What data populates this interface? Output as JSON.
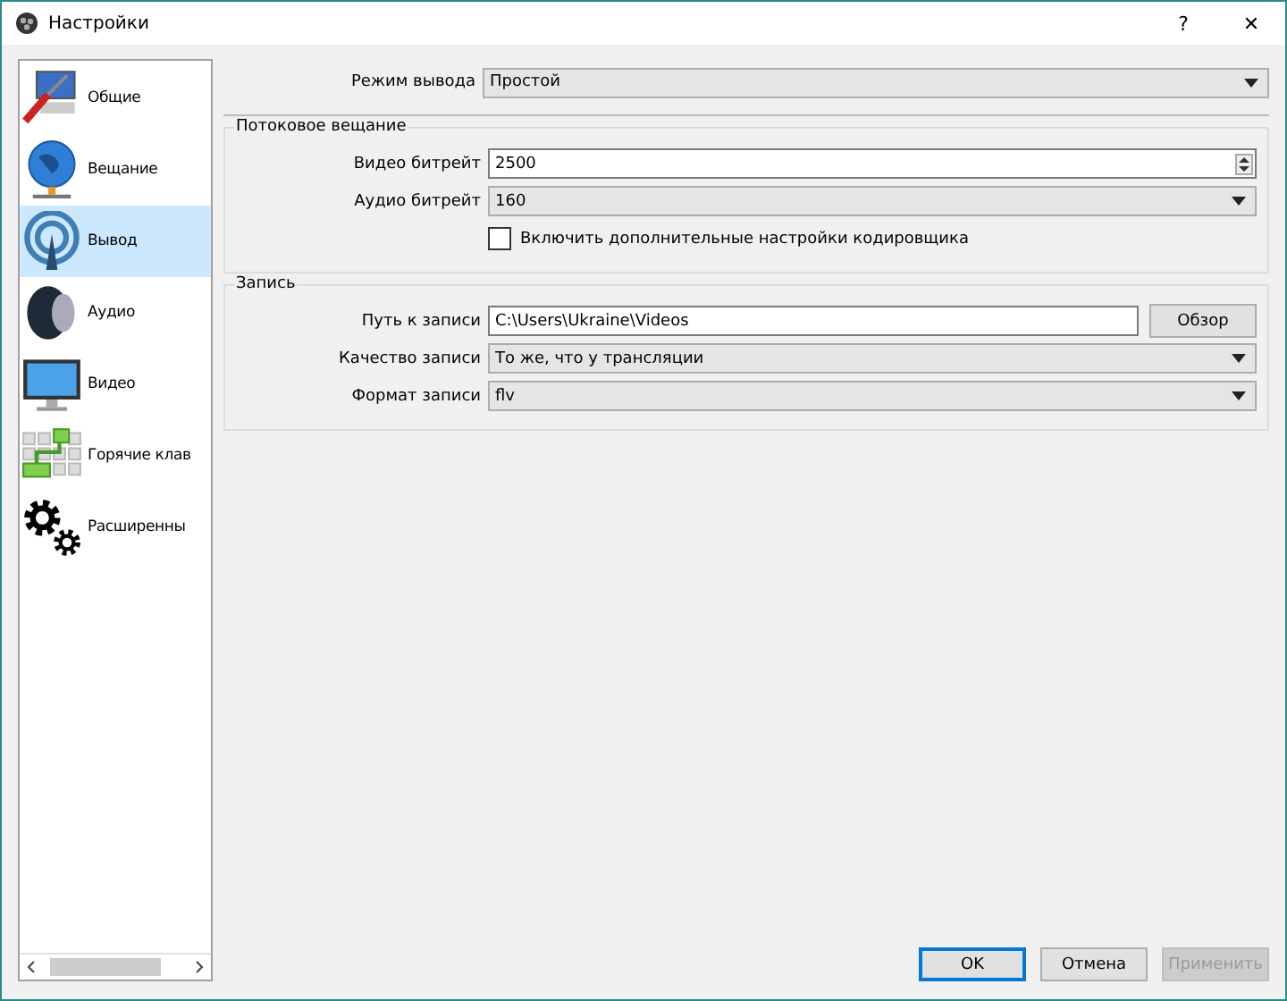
{
  "window": {
    "title": "Настройки",
    "help": "?",
    "close": "✕"
  },
  "sidebar": {
    "items": [
      {
        "label": "Общие",
        "kind": "general",
        "selected": false
      },
      {
        "label": "Вещание",
        "kind": "stream",
        "selected": false
      },
      {
        "label": "Вывод",
        "kind": "output",
        "selected": true
      },
      {
        "label": "Аудио",
        "kind": "audio",
        "selected": false
      },
      {
        "label": "Видео",
        "kind": "video",
        "selected": false
      },
      {
        "label": "Горячие клав",
        "kind": "hotkeys",
        "selected": false
      },
      {
        "label": "Расширенны",
        "kind": "advanced",
        "selected": false
      }
    ]
  },
  "top": {
    "label": "Режим вывода",
    "kind": "combo",
    "value": "Простой"
  },
  "groups": [
    {
      "title": "Потоковое вещание",
      "fields": [
        {
          "label": "Видео битрейт",
          "kind": "spin",
          "value": "2500"
        },
        {
          "label": "Аудио битрейт",
          "kind": "combo",
          "value": "160"
        },
        {
          "label": "Включить дополнительные настройки кодировщика",
          "kind": "checkbox",
          "checked": false
        }
      ]
    },
    {
      "title": "Запись",
      "fields": [
        {
          "label": "Путь к записи",
          "kind": "path",
          "value": "C:\\Users\\Ukraine\\Videos",
          "button": "Обзор"
        },
        {
          "label": "Качество записи",
          "kind": "combo",
          "value": "То же, что у трансляции"
        },
        {
          "label": "Формат записи",
          "kind": "combo",
          "value": "flv"
        }
      ]
    }
  ],
  "buttons": [
    {
      "label": "OK",
      "default": true,
      "disabled": false
    },
    {
      "label": "Отмена",
      "default": false,
      "disabled": false
    },
    {
      "label": "Применить",
      "default": false,
      "disabled": true
    }
  ]
}
